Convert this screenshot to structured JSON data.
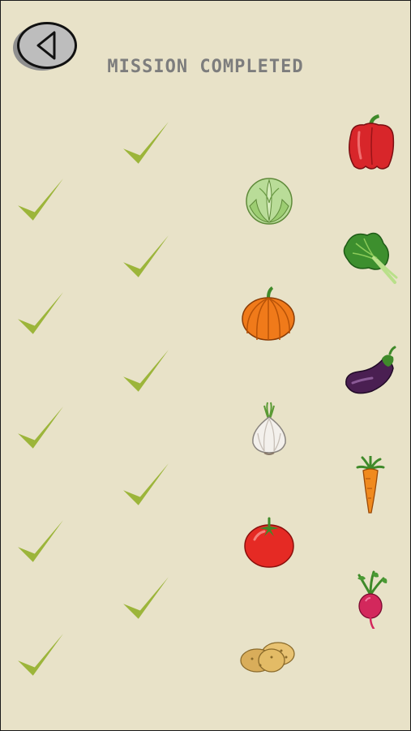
{
  "header": {
    "title": "MISSION COMPLETED"
  },
  "icons": {
    "back": "back-arrow-icon",
    "check": "checkmark-icon"
  },
  "colors": {
    "background": "#e8e2c8",
    "check": "#9cb53a",
    "title": "#7d7d7d"
  },
  "vegetables": [
    "red-pepper",
    "cabbage",
    "spinach",
    "pumpkin",
    "eggplant",
    "garlic",
    "carrot",
    "tomato",
    "beet",
    "potato"
  ]
}
